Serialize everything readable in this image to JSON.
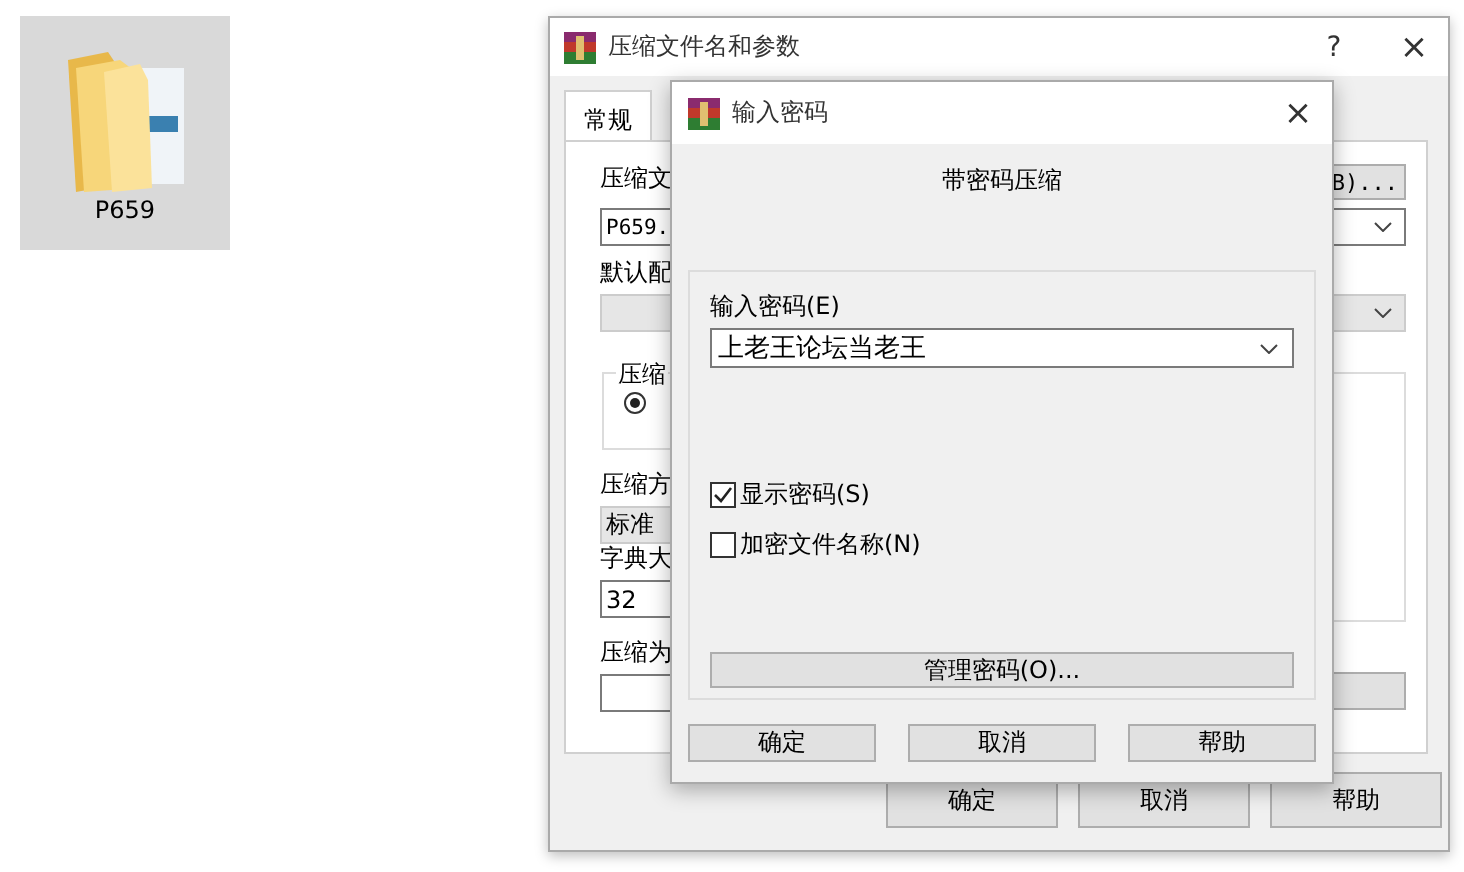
{
  "desktop_icon": {
    "label": "P659",
    "selected": true
  },
  "main_window": {
    "title": "压缩文件名和参数",
    "help": "?",
    "close": "×",
    "tabs": [
      {
        "label": "常规",
        "selected": true
      }
    ],
    "archive_label": "压缩文",
    "browse_button": "B)...",
    "archive_name": "P659.",
    "profile_label": "默认配",
    "profile_value_disabled": true,
    "group_title": "压缩",
    "radio_selected": true,
    "method_label": "压缩方",
    "method_value": "标准",
    "dict_label": "字典大",
    "dict_value": "32",
    "split_label": "压缩为",
    "buttons": [
      {
        "label": "确定"
      },
      {
        "label": "取消"
      },
      {
        "label": "帮助"
      }
    ]
  },
  "password_dialog": {
    "title": "输入密码",
    "close": "×",
    "heading": "带密码压缩",
    "password_label": "输入密码(E)",
    "password_value": "上老王论坛当老王",
    "options": [
      {
        "label": "显示密码(S)",
        "checked": true
      },
      {
        "label": "加密文件名称(N)",
        "checked": false
      }
    ],
    "manage_button": "管理密码(O)...",
    "buttons": [
      {
        "label": "确定"
      },
      {
        "label": "取消"
      },
      {
        "label": "帮助"
      }
    ]
  }
}
